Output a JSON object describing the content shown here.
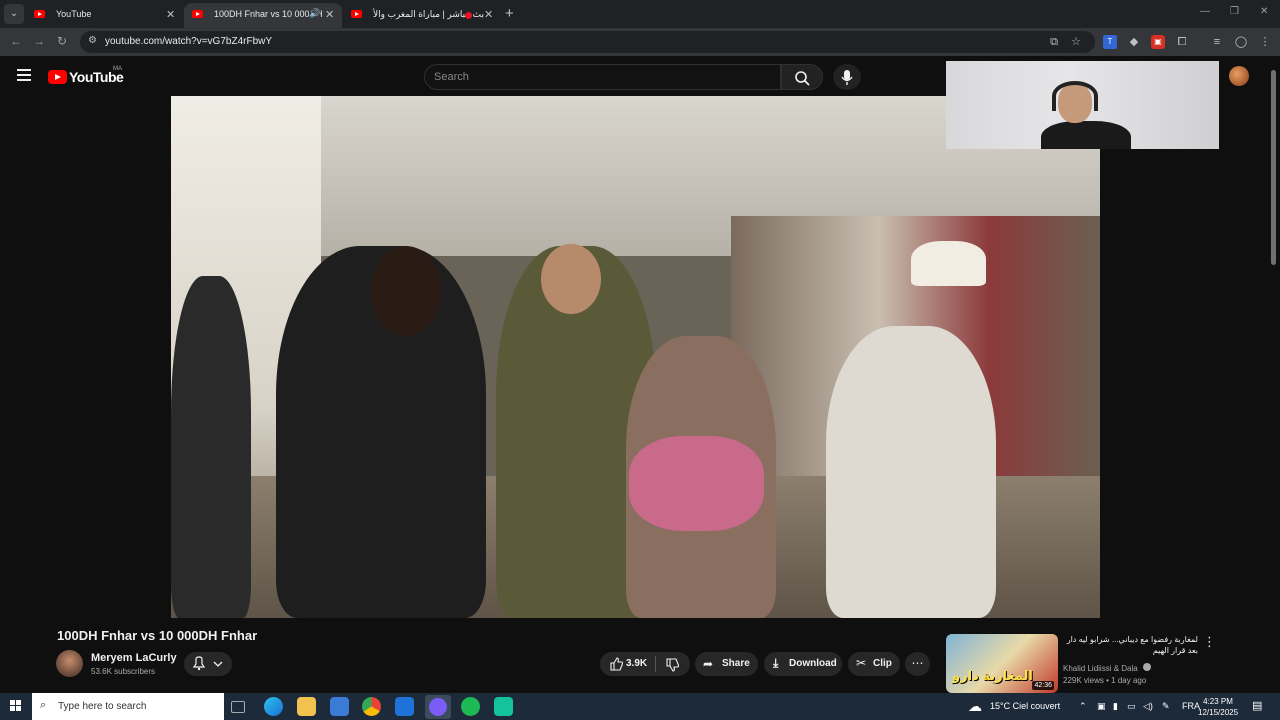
{
  "browser": {
    "tabs": [
      {
        "title": "YouTube"
      },
      {
        "title": "100DH Fnhar vs 10 000DH F"
      },
      {
        "title": "بث مباشر | مباراة المغرب والأ"
      }
    ],
    "url": "youtube.com/watch?v=vG7bZ4rFbwY",
    "new_tab_glyph": "+"
  },
  "youtube": {
    "logo_text": "YouTube",
    "country_code": "MA",
    "search_placeholder": "Search"
  },
  "video": {
    "title": "100DH Fnhar vs 10 000DH Fnhar",
    "channel": "Meryem LaCurly",
    "subscribers": "53.6K subscribers",
    "likes": "3.9K",
    "share_label": "Share",
    "download_label": "Download",
    "clip_label": "Clip"
  },
  "recommendation": {
    "title": "لمغاربة رفضوا مع ديباني... شرابو ليه دار بعد قرار الهيم",
    "channel": "Khalid Lidiissi & Dala",
    "meta": "229K views • 1 day ago",
    "duration": "42:36",
    "thumb_text": "المغاربة دارو"
  },
  "taskbar": {
    "search_placeholder": "Type here to search",
    "weather": "15°C  Ciel couvert",
    "lang": "FRA",
    "time": "4:23 PM",
    "date": "12/15/2025"
  },
  "colors": {
    "bg": "#0f0f0f",
    "brand_red": "#ff0000",
    "pill": "#272727"
  }
}
